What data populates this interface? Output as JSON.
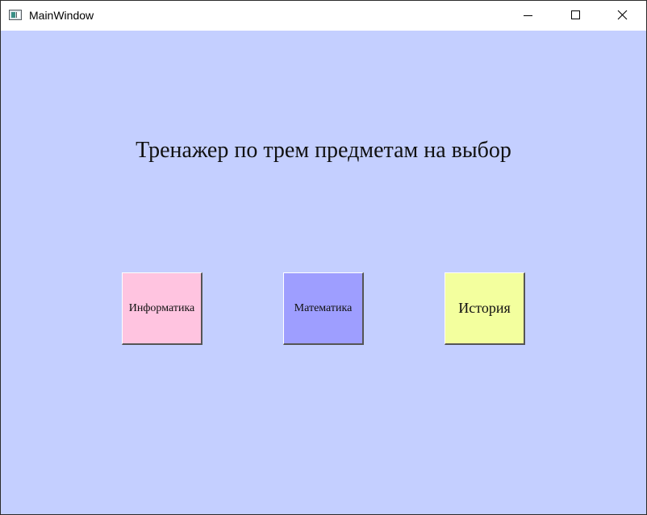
{
  "window": {
    "title": "MainWindow",
    "background_color": "#c4cfff"
  },
  "caption_buttons": {
    "minimize": "minimize-icon",
    "maximize": "maximize-icon",
    "close": "close-icon"
  },
  "main": {
    "heading": "Тренажер по трем предметам на выбор",
    "buttons": [
      {
        "label": "Информатика",
        "color": "#ffc4e0"
      },
      {
        "label": "Математика",
        "color": "#9e9eff"
      },
      {
        "label": "История",
        "color": "#f3ff9e"
      }
    ]
  }
}
